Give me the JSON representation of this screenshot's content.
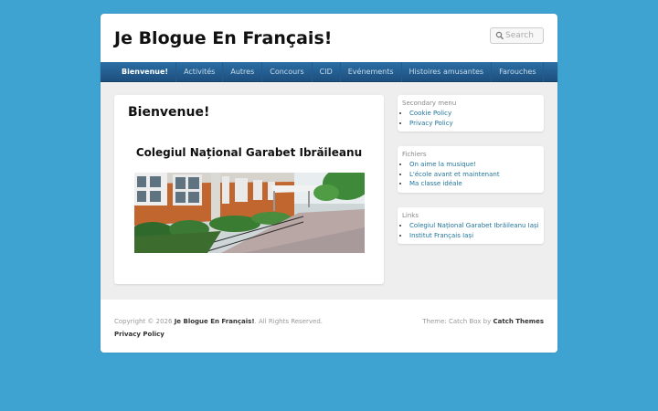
{
  "site": {
    "title": "Je Blogue En Français!"
  },
  "search": {
    "placeholder": "Search"
  },
  "nav": {
    "items": [
      "Bienvenue!",
      "Activités",
      "Autres",
      "Concours",
      "CID",
      "Evénements",
      "Histoires amusantes",
      "Farouches"
    ],
    "active": "Bienvenue!"
  },
  "main": {
    "title": "Bienvenue!",
    "subtitle": "Colegiul Național Garabet Ibrăileanu"
  },
  "sidebar": {
    "secondary": {
      "title": "Secondary menu",
      "items": [
        "Cookie Policy",
        "Privacy Policy"
      ]
    },
    "fichiers": {
      "title": "Fichiers",
      "items": [
        "On aime la musique!",
        "L'école avant et maintenant",
        "Ma classe idéale"
      ]
    },
    "links": {
      "title": "Links",
      "items": [
        "Colegiul Național Garabet Ibrăileanu Iași",
        "Institut Français Iași"
      ]
    }
  },
  "footer": {
    "copyright_prefix": "Copyright © 2026",
    "site_name": "Je Blogue En Français!",
    "rights": ". All Rights Reserved.",
    "policy": "Privacy Policy",
    "theme_prefix": "Theme: Catch Box by",
    "theme_author": "Catch Themes"
  },
  "colors": {
    "background": "#3fa3d1",
    "nav": "#1e4f7d",
    "link": "#21759b"
  }
}
